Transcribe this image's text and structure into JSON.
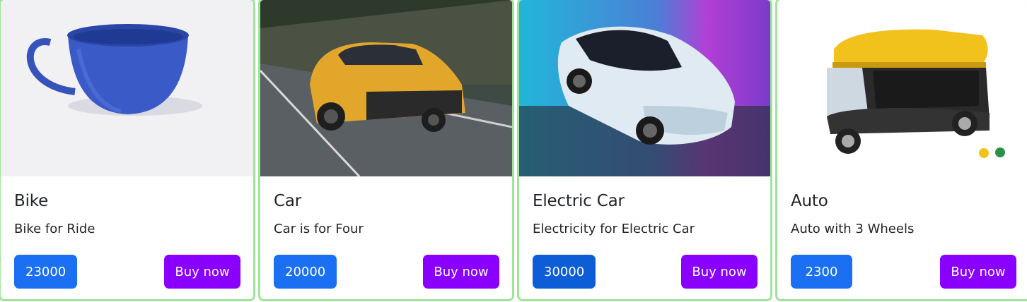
{
  "products": [
    {
      "title": "Bike",
      "description": "Bike for Ride",
      "price": "23000",
      "button": "Buy now",
      "image_icon": "blue-cup-image",
      "price_color": "#1a6ff2"
    },
    {
      "title": "Car",
      "description": "Car is for Four",
      "price": "20000",
      "button": "Buy now",
      "image_icon": "yellow-suv-image",
      "price_color": "#1a6ff2"
    },
    {
      "title": "Electric Car",
      "description": "Electricity for Electric Car",
      "price": "30000",
      "button": "Buy now",
      "image_icon": "white-electric-car-image",
      "price_color": "#0d5ed6"
    },
    {
      "title": "Auto",
      "description": "Auto with 3 Wheels",
      "price": "2300",
      "button": "Buy now",
      "image_icon": "auto-rickshaw-image",
      "price_color": "#1a6ff2"
    }
  ],
  "colors": {
    "buy_button": "#8a00ff",
    "card_border": "#9ee59a"
  }
}
